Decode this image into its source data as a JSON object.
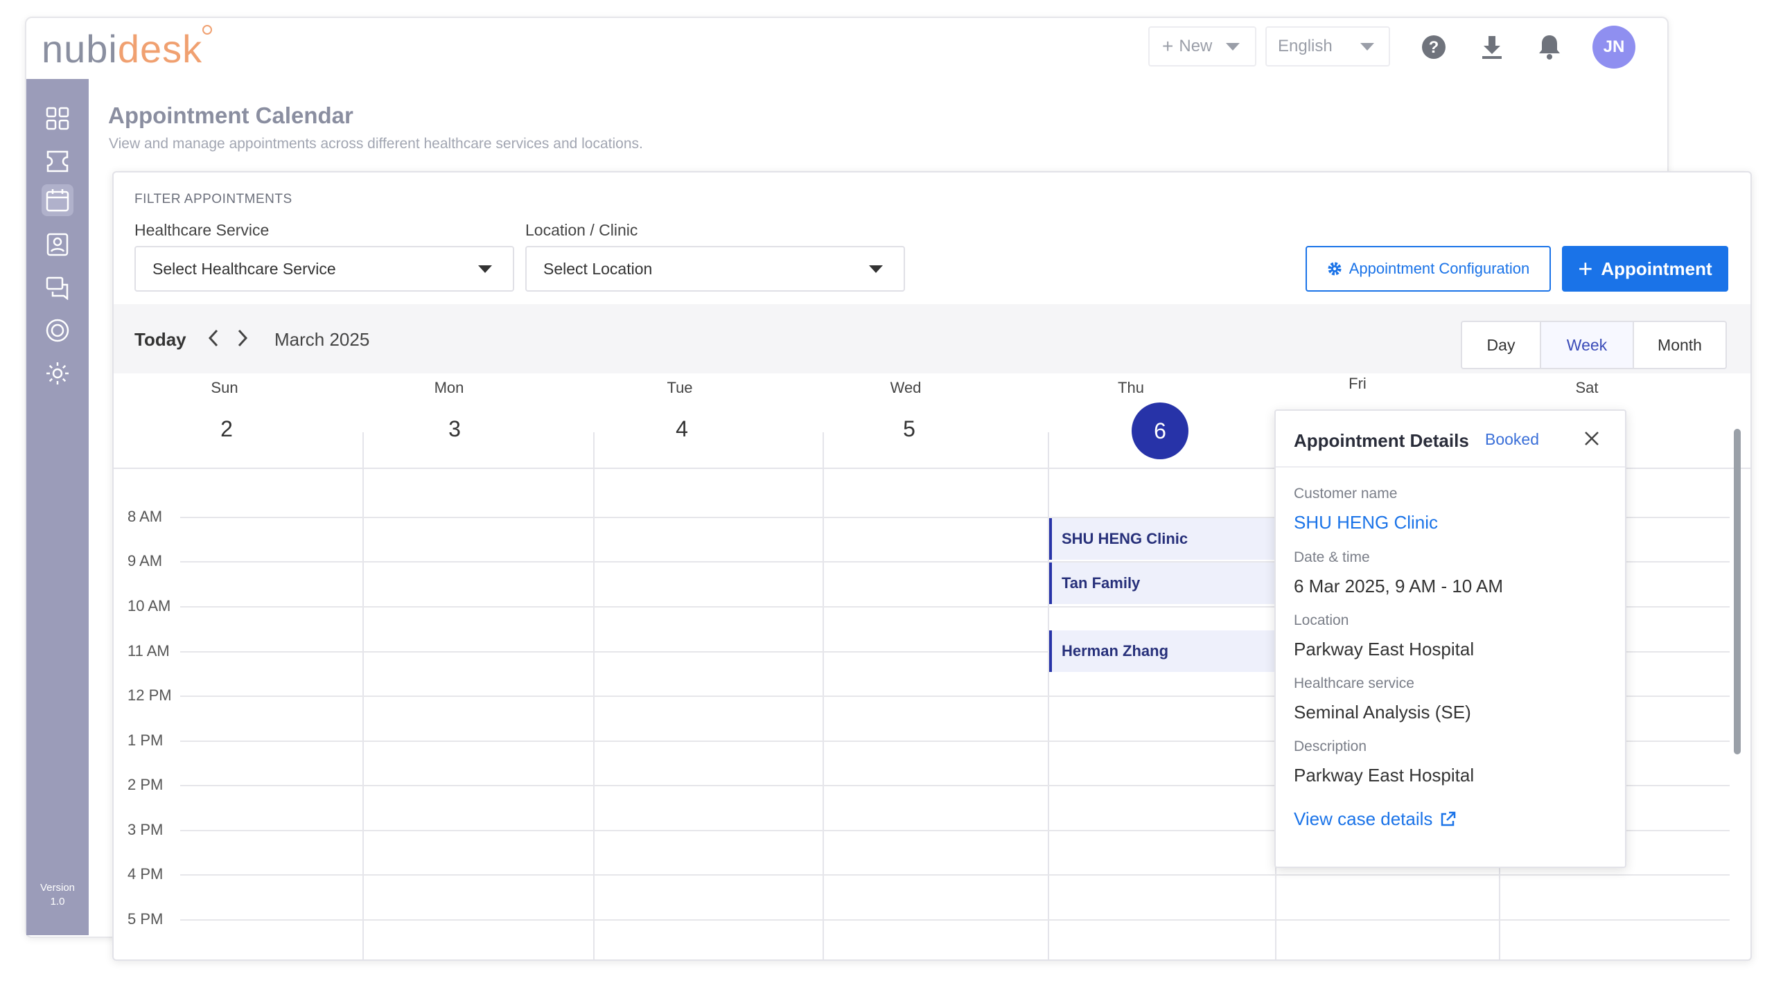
{
  "app": {
    "logo": {
      "part1": "nubi",
      "part2": "desk"
    },
    "topbar": {
      "new_label": "New",
      "language": "English",
      "avatar_initials": "JN",
      "icons": [
        "help-icon",
        "download-icon",
        "bell-icon"
      ]
    },
    "sidebar": {
      "icons": [
        "dashboard-icon",
        "tickets-icon",
        "calendar-icon",
        "contacts-icon",
        "chat-icon",
        "support-icon",
        "settings-icon"
      ],
      "active": "calendar-icon",
      "version_label": "Version",
      "version_number": "1.0"
    }
  },
  "page": {
    "title": "Appointment Calendar",
    "subtitle": "View and manage appointments across different healthcare services and locations."
  },
  "filters": {
    "heading": "FILTER APPOINTMENTS",
    "service_label": "Healthcare Service",
    "service_value": "Select Healthcare Service",
    "location_label": "Location / Clinic",
    "location_value": "Select Location",
    "config_button": "Appointment Configuration",
    "add_button": "Appointment"
  },
  "calendar": {
    "today_label": "Today",
    "month_label": "March 2025",
    "views": [
      "Day",
      "Week",
      "Month"
    ],
    "active_view": "Week",
    "days": [
      {
        "name": "Sun",
        "num": "2"
      },
      {
        "name": "Mon",
        "num": "3"
      },
      {
        "name": "Tue",
        "num": "4"
      },
      {
        "name": "Wed",
        "num": "5"
      },
      {
        "name": "Thu",
        "num": "6"
      },
      {
        "name": "Fri",
        "num": ""
      },
      {
        "name": "Sat",
        "num": ""
      }
    ],
    "today_index": 4,
    "times": [
      "8 AM",
      "9 AM",
      "10 AM",
      "11 AM",
      "12 PM",
      "1 PM",
      "2 PM",
      "3 PM",
      "4 PM",
      "5 PM"
    ],
    "events": [
      {
        "name": "SHU HENG Clinic"
      },
      {
        "name": "Tan Family"
      },
      {
        "name": "Herman Zhang"
      }
    ]
  },
  "popup": {
    "title": "Appointment Details",
    "status": "Booked",
    "customer_label": "Customer name",
    "customer_value": "SHU HENG Clinic",
    "datetime_label": "Date & time",
    "datetime_value": "6 Mar 2025, 9 AM - 10 AM",
    "location_label": "Location",
    "location_value": "Parkway East Hospital",
    "service_label": "Healthcare service",
    "service_value": "Seminal Analysis (SE)",
    "description_label": "Description",
    "description_value": "Parkway East Hospital",
    "link_label": "View case details"
  },
  "colors": {
    "primary": "#1a73e8",
    "today": "#2733a8",
    "sidebar": "#9b9cb9",
    "event_bg": "#eef0fb"
  }
}
